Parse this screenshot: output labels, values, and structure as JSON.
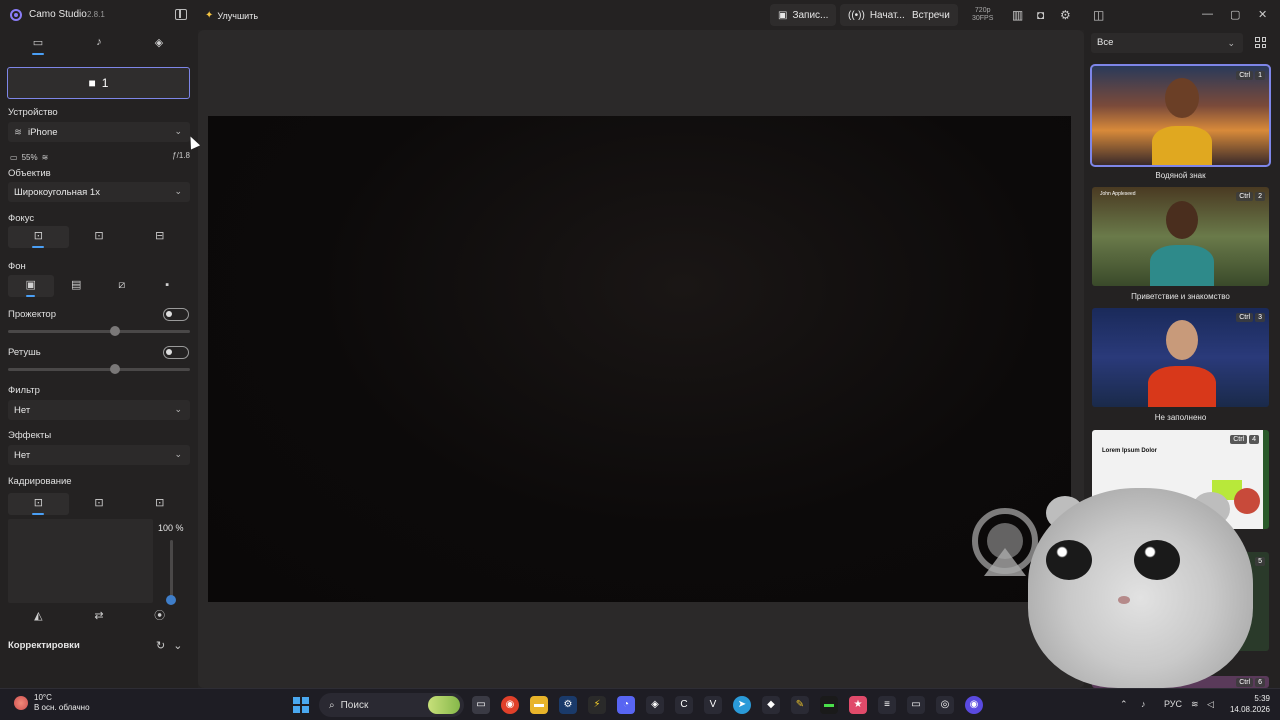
{
  "titlebar": {
    "app_name": "Camo Studio",
    "version": "2.8.1",
    "enhance_label": "Улучшить",
    "record_label": "Запис...",
    "live_label": "Начат...",
    "meetings_label": "Встречи",
    "resolution": "720p",
    "fps": "30FPS"
  },
  "sidebar": {
    "camera_label": "1",
    "device_label": "Устройство",
    "device_value": "iPhone",
    "battery": "55%",
    "aperture": "ƒ/1.8",
    "lens_label": "Объектив",
    "lens_value": "Широкоугольная 1x",
    "focus_label": "Фокус",
    "background_label": "Фон",
    "spotlight_label": "Прожектор",
    "spotlight_level": 0.59,
    "retouch_label": "Ретушь",
    "retouch_level": 0.59,
    "filter_label": "Фильтр",
    "filter_value": "Нет",
    "effects_label": "Эффекты",
    "effects_value": "Нет",
    "crop_label": "Кадрирование",
    "zoom_value": "100 %",
    "corrections_label": "Корректировки"
  },
  "scenes": {
    "filter_value": "Все",
    "items": [
      {
        "label": "Водяной знак",
        "key1": "Ctrl",
        "key2": "1"
      },
      {
        "label": "Приветствие и знакомство",
        "key1": "Ctrl",
        "key2": "2",
        "overlay_name": "John Appleseed"
      },
      {
        "label": "Не заполнено",
        "key1": "Ctrl",
        "key2": "3"
      },
      {
        "label": "",
        "key1": "Ctrl",
        "key2": "4",
        "card_title": "Lorem Ipsum Dolor"
      },
      {
        "label": "",
        "key1": "",
        "key2": "5"
      },
      {
        "label": "",
        "key1": "Ctrl",
        "key2": "6"
      }
    ]
  },
  "taskbar": {
    "temperature": "10°C",
    "weather": "В осн. облачно",
    "search_placeholder": "Поиск",
    "language": "РУС",
    "time": "5:39",
    "date": "14.08.2026"
  },
  "colors": {
    "accent": "#7e86e8",
    "active_tab": "#4a9ff5",
    "background": "#262424"
  }
}
